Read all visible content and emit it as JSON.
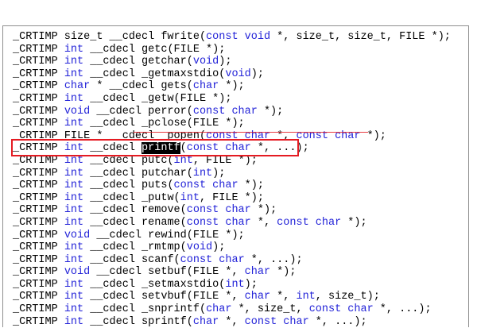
{
  "code_lines": [
    [
      {
        "t": "_CRTIMP size_t __cdecl fwrite("
      },
      {
        "t": "const void",
        "k": 1
      },
      {
        "t": " *, size_t, size_t, FILE *);"
      }
    ],
    [
      {
        "t": "_CRTIMP "
      },
      {
        "t": "int",
        "k": 1
      },
      {
        "t": " __cdecl getc(FILE *);"
      }
    ],
    [
      {
        "t": "_CRTIMP "
      },
      {
        "t": "int",
        "k": 1
      },
      {
        "t": " __cdecl getchar("
      },
      {
        "t": "void",
        "k": 1
      },
      {
        "t": ");"
      }
    ],
    [
      {
        "t": "_CRTIMP "
      },
      {
        "t": "int",
        "k": 1
      },
      {
        "t": " __cdecl _getmaxstdio("
      },
      {
        "t": "void",
        "k": 1
      },
      {
        "t": ");"
      }
    ],
    [
      {
        "t": "_CRTIMP "
      },
      {
        "t": "char",
        "k": 1
      },
      {
        "t": " * __cdecl gets("
      },
      {
        "t": "char",
        "k": 1
      },
      {
        "t": " *);"
      }
    ],
    [
      {
        "t": "_CRTIMP "
      },
      {
        "t": "int",
        "k": 1
      },
      {
        "t": " __cdecl _getw(FILE *);"
      }
    ],
    [
      {
        "t": "_CRTIMP "
      },
      {
        "t": "void",
        "k": 1
      },
      {
        "t": " __cdecl perror("
      },
      {
        "t": "const char",
        "k": 1
      },
      {
        "t": " *);"
      }
    ],
    [
      {
        "t": "_CRTIMP "
      },
      {
        "t": "int",
        "k": 1
      },
      {
        "t": " __cdecl _pclose(FILE *);"
      }
    ],
    [
      {
        "t": "_CRTIMP FILE * __cdecl _popen("
      },
      {
        "t": "const char",
        "k": 1
      },
      {
        "t": " *, "
      },
      {
        "t": "const char",
        "k": 1
      },
      {
        "t": " *);"
      }
    ],
    [
      {
        "t": "_CRTIMP "
      },
      {
        "t": "int",
        "k": 1
      },
      {
        "t": " __cdecl "
      },
      {
        "t": "printf",
        "h": 1
      },
      {
        "t": "("
      },
      {
        "t": "const char",
        "k": 1
      },
      {
        "t": " *, ...);"
      }
    ],
    [
      {
        "t": "_CRTIMP "
      },
      {
        "t": "int",
        "k": 1
      },
      {
        "t": " __cdecl putc("
      },
      {
        "t": "int",
        "k": 1
      },
      {
        "t": ", FILE *);"
      }
    ],
    [
      {
        "t": "_CRTIMP "
      },
      {
        "t": "int",
        "k": 1
      },
      {
        "t": " __cdecl putchar("
      },
      {
        "t": "int",
        "k": 1
      },
      {
        "t": ");"
      }
    ],
    [
      {
        "t": "_CRTIMP "
      },
      {
        "t": "int",
        "k": 1
      },
      {
        "t": " __cdecl puts("
      },
      {
        "t": "const char",
        "k": 1
      },
      {
        "t": " *);"
      }
    ],
    [
      {
        "t": "_CRTIMP "
      },
      {
        "t": "int",
        "k": 1
      },
      {
        "t": " __cdecl _putw("
      },
      {
        "t": "int",
        "k": 1
      },
      {
        "t": ", FILE *);"
      }
    ],
    [
      {
        "t": "_CRTIMP "
      },
      {
        "t": "int",
        "k": 1
      },
      {
        "t": " __cdecl remove("
      },
      {
        "t": "const char",
        "k": 1
      },
      {
        "t": " *);"
      }
    ],
    [
      {
        "t": "_CRTIMP "
      },
      {
        "t": "int",
        "k": 1
      },
      {
        "t": " __cdecl rename("
      },
      {
        "t": "const char",
        "k": 1
      },
      {
        "t": " *, "
      },
      {
        "t": "const char",
        "k": 1
      },
      {
        "t": " *);"
      }
    ],
    [
      {
        "t": "_CRTIMP "
      },
      {
        "t": "void",
        "k": 1
      },
      {
        "t": " __cdecl rewind(FILE *);"
      }
    ],
    [
      {
        "t": "_CRTIMP "
      },
      {
        "t": "int",
        "k": 1
      },
      {
        "t": " __cdecl _rmtmp("
      },
      {
        "t": "void",
        "k": 1
      },
      {
        "t": ");"
      }
    ],
    [
      {
        "t": "_CRTIMP "
      },
      {
        "t": "int",
        "k": 1
      },
      {
        "t": " __cdecl scanf("
      },
      {
        "t": "const char",
        "k": 1
      },
      {
        "t": " *, ...);"
      }
    ],
    [
      {
        "t": "_CRTIMP "
      },
      {
        "t": "void",
        "k": 1
      },
      {
        "t": " __cdecl setbuf(FILE *, "
      },
      {
        "t": "char",
        "k": 1
      },
      {
        "t": " *);"
      }
    ],
    [
      {
        "t": "_CRTIMP "
      },
      {
        "t": "int",
        "k": 1
      },
      {
        "t": " __cdecl _setmaxstdio("
      },
      {
        "t": "int",
        "k": 1
      },
      {
        "t": ");"
      }
    ],
    [
      {
        "t": "_CRTIMP "
      },
      {
        "t": "int",
        "k": 1
      },
      {
        "t": " __cdecl setvbuf(FILE *, "
      },
      {
        "t": "char",
        "k": 1
      },
      {
        "t": " *, "
      },
      {
        "t": "int",
        "k": 1
      },
      {
        "t": ", size_t);"
      }
    ],
    [
      {
        "t": "_CRTIMP "
      },
      {
        "t": "int",
        "k": 1
      },
      {
        "t": " __cdecl _snprintf("
      },
      {
        "t": "char",
        "k": 1
      },
      {
        "t": " *, size_t, "
      },
      {
        "t": "const char",
        "k": 1
      },
      {
        "t": " *, ...);"
      }
    ],
    [
      {
        "t": "_CRTIMP "
      },
      {
        "t": "int",
        "k": 1
      },
      {
        "t": " __cdecl sprintf("
      },
      {
        "t": "char",
        "k": 1
      },
      {
        "t": " *, "
      },
      {
        "t": "const char",
        "k": 1
      },
      {
        "t": " *, ...);"
      }
    ]
  ],
  "highlight_color": "#e51b22",
  "keyword_color": "#2323d8"
}
